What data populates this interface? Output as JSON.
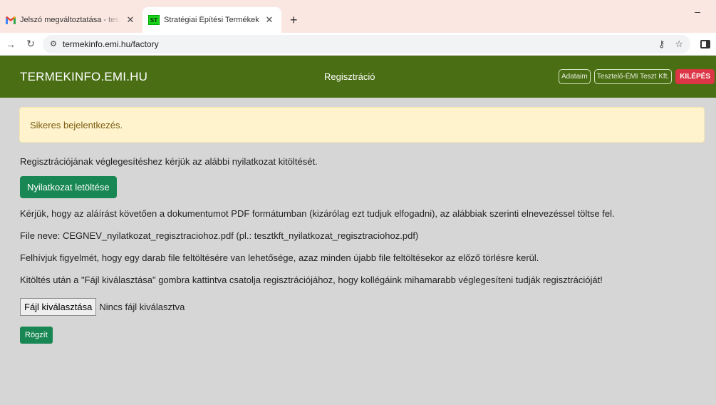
{
  "browser": {
    "tabs": [
      {
        "title": "Jelszó megváltoztatása - tesztkft",
        "icon": "gmail-icon",
        "active": false
      },
      {
        "title": "Stratégiai Építési Termékek",
        "icon": "ST",
        "active": true
      }
    ],
    "new_tab": "+",
    "minimize": "–",
    "url": "termekinfo.emi.hu/factory"
  },
  "header": {
    "brand": "TERMEKINFO.EMI.HU",
    "nav_center": "Regisztráció",
    "profile_btn": "Adataim",
    "company_btn": "Tesztelő-ÉMI Teszt Kft.",
    "logout_btn": "KILÉPÉS",
    "bg_color": "#4a6e14"
  },
  "content": {
    "alert": "Sikeres bejelentkezés.",
    "intro": "Regisztrációjának véglegesítéshez kérjük az alábbi nyilatkozat kitöltését.",
    "download_btn": "Nyilatkozat letöltése",
    "instruction": "Kérjük, hogy az aláírást követően a dokumentumot PDF formátumban (kizárólag ezt tudjuk elfogadni), az alábbiak szerinti elnevezéssel töltse fel.",
    "filename_hint": "File neve: CEGNEV_nyilatkozat_regisztraciohoz.pdf (pl.: tesztkft_nyilatkozat_regisztraciohoz.pdf)",
    "single_file_note": "Felhívjuk figyelmét, hogy egy darab file feltöltésére van lehetősége, azaz minden újabb file feltöltésekor az előző törlésre kerül.",
    "attach_note": "Kitöltés után a \"Fájl kiválasztása\" gombra kattintva csatolja regisztrációjához, hogy kollégáink mihamarabb véglegesíteni tudják regisztrációját!",
    "file_button": "Fájl kiválasztása",
    "file_status": "Nincs fájl kiválasztva",
    "submit_btn": "Rögzít"
  },
  "colors": {
    "primary_green": "#198754",
    "danger": "#dc3545",
    "alert_bg": "#fef3cd"
  }
}
